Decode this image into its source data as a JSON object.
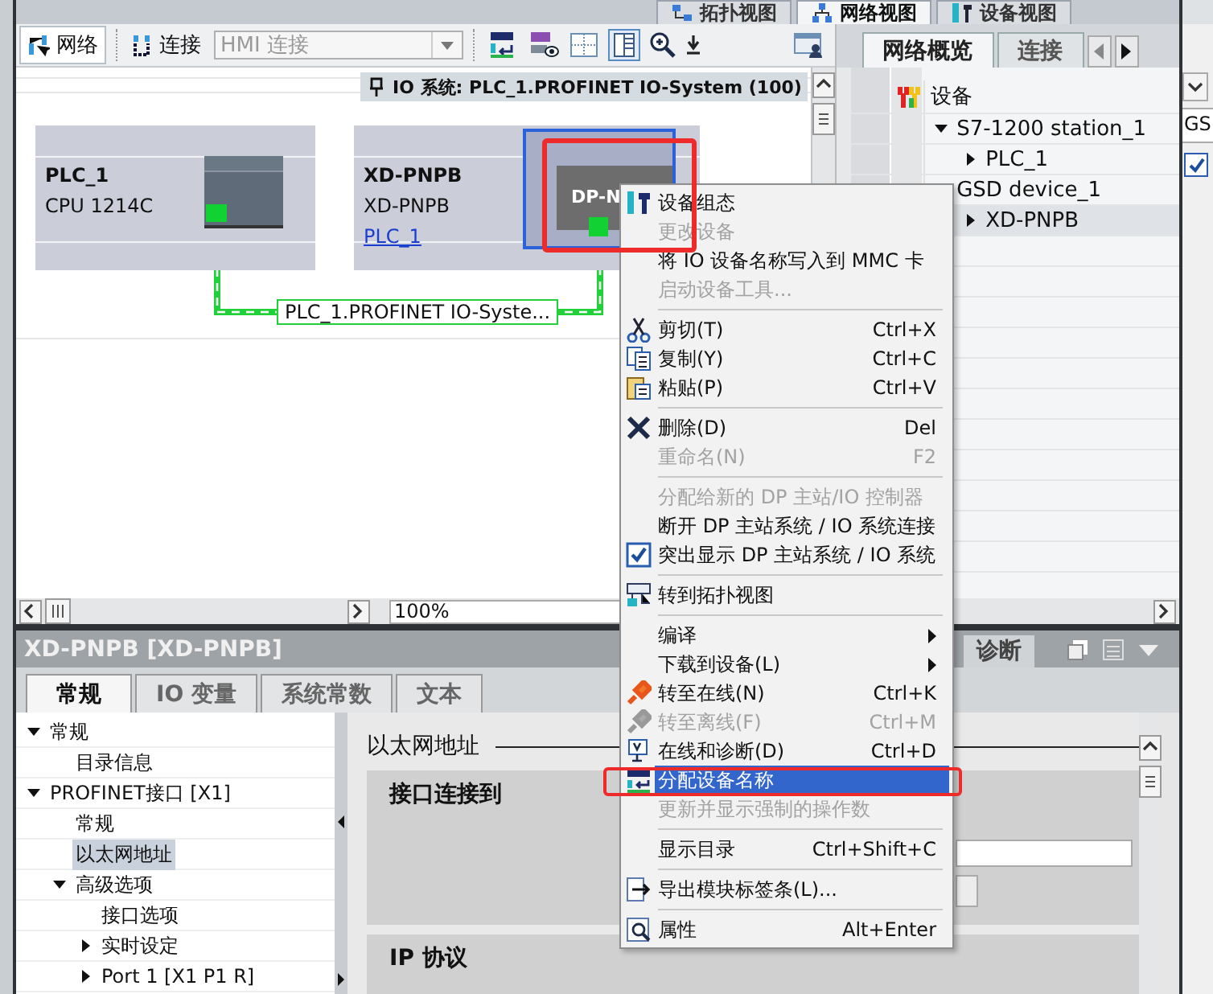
{
  "view_tabs": [
    {
      "label": "拓扑视图",
      "selected": false
    },
    {
      "label": "网络视图",
      "selected": true
    },
    {
      "label": "设备视图",
      "selected": false
    }
  ],
  "side_panel": {
    "field": "GS",
    "checked": true
  },
  "toolbar": {
    "network_button": "网络",
    "connections_label": "连接",
    "connection_type": "HMI 连接"
  },
  "io_system": "IO 系统: PLC_1.PROFINET IO-System (100)",
  "devices": [
    {
      "kind": "plc",
      "name": "PLC_1",
      "type": "CPU 1214C",
      "selected": false
    },
    {
      "kind": "io_device",
      "name": "XD-PNPB",
      "type": "XD-PNPB",
      "controller": "PLC_1",
      "module": "DP-N",
      "selected": true
    }
  ],
  "subnet_label": "PLC_1.PROFINET IO-Syste...",
  "zoom": "100%",
  "overview": {
    "tabs": [
      {
        "label": "网络概览",
        "selected": true
      },
      {
        "label": "连接",
        "selected": false
      }
    ],
    "column": "设备",
    "rows": [
      {
        "label": "S7-1200 station_1",
        "expanded": true,
        "selected": false,
        "children": [
          {
            "label": "PLC_1",
            "expanded": false,
            "selected": false
          }
        ]
      },
      {
        "label": "GSD device_1",
        "selected": false,
        "children": [
          {
            "label": "XD-PNPB",
            "expanded": false,
            "selected": true
          }
        ]
      }
    ]
  },
  "properties": {
    "title": "XD-PNPB [XD-PNPB]",
    "side_tab": "诊断",
    "tabs": [
      {
        "label": "常规",
        "selected": true
      },
      {
        "label": "IO 变量",
        "selected": false
      },
      {
        "label": "系统常数",
        "selected": false
      },
      {
        "label": "文本",
        "selected": false
      }
    ],
    "tree": [
      {
        "label": "常规",
        "expanded": true,
        "selected": false,
        "children": [
          {
            "label": "目录信息",
            "selected": false
          }
        ]
      },
      {
        "label": "PROFINET接口 [X1]",
        "expanded": true,
        "selected": false,
        "children": [
          {
            "label": "常规",
            "selected": false
          },
          {
            "label": "以太网地址",
            "selected": true
          },
          {
            "label": "高级选项",
            "expanded": true,
            "selected": false,
            "children": [
              {
                "label": "接口选项",
                "selected": false
              },
              {
                "label": "实时设定",
                "expanded": false,
                "selected": false
              },
              {
                "label": "Port 1 [X1 P1 R]",
                "expanded": false,
                "selected": false
              }
            ]
          }
        ]
      }
    ],
    "section": "以太网地址",
    "groups": [
      "接口连接到",
      "IP 协议"
    ]
  },
  "context_menu": [
    {
      "kind": "command",
      "label": "设备组态",
      "disabled": false,
      "selected": false
    },
    {
      "kind": "command",
      "label": "更改设备",
      "disabled": true,
      "selected": false
    },
    {
      "kind": "command",
      "label": "将 IO 设备名称写入到 MMC 卡",
      "disabled": false,
      "selected": false
    },
    {
      "kind": "command",
      "label": "启动设备工具...",
      "disabled": true,
      "selected": false
    },
    {
      "kind": "separator"
    },
    {
      "kind": "command",
      "label": "剪切(T)",
      "shortcut": "Ctrl+X",
      "disabled": false,
      "selected": false
    },
    {
      "kind": "command",
      "label": "复制(Y)",
      "shortcut": "Ctrl+C",
      "disabled": false,
      "selected": false
    },
    {
      "kind": "command",
      "label": "粘贴(P)",
      "shortcut": "Ctrl+V",
      "disabled": false,
      "selected": false
    },
    {
      "kind": "separator"
    },
    {
      "kind": "command",
      "label": "删除(D)",
      "shortcut": "Del",
      "disabled": false,
      "selected": false
    },
    {
      "kind": "command",
      "label": "重命名(N)",
      "shortcut": "F2",
      "disabled": true,
      "selected": false
    },
    {
      "kind": "separator"
    },
    {
      "kind": "command",
      "label": "分配给新的 DP 主站/IO 控制器",
      "disabled": true,
      "selected": false
    },
    {
      "kind": "command",
      "label": "断开 DP 主站系统 / IO 系统连接",
      "disabled": false,
      "selected": false
    },
    {
      "kind": "check",
      "label": "突出显示 DP 主站系统 / IO 系统",
      "checked": true,
      "disabled": false,
      "selected": false
    },
    {
      "kind": "separator"
    },
    {
      "kind": "command",
      "label": "转到拓扑视图",
      "disabled": false,
      "selected": false
    },
    {
      "kind": "separator"
    },
    {
      "kind": "submenu",
      "label": "编译",
      "disabled": false,
      "selected": false
    },
    {
      "kind": "submenu",
      "label": "下载到设备(L)",
      "disabled": false,
      "selected": false
    },
    {
      "kind": "command",
      "label": "转至在线(N)",
      "shortcut": "Ctrl+K",
      "disabled": false,
      "selected": false
    },
    {
      "kind": "command",
      "label": "转至离线(F)",
      "shortcut": "Ctrl+M",
      "disabled": true,
      "selected": false
    },
    {
      "kind": "command",
      "label": "在线和诊断(D)",
      "shortcut": "Ctrl+D",
      "disabled": false,
      "selected": false
    },
    {
      "kind": "command",
      "label": "分配设备名称",
      "disabled": false,
      "selected": true
    },
    {
      "kind": "command",
      "label": "更新并显示强制的操作数",
      "disabled": true,
      "selected": false
    },
    {
      "kind": "separator"
    },
    {
      "kind": "command",
      "label": "显示目录",
      "shortcut": "Ctrl+Shift+C",
      "disabled": false,
      "selected": false
    },
    {
      "kind": "separator"
    },
    {
      "kind": "command",
      "label": "导出模块标签条(L)...",
      "disabled": false,
      "selected": false
    },
    {
      "kind": "separator"
    },
    {
      "kind": "command",
      "label": "属性",
      "shortcut": "Alt+Enter",
      "disabled": false,
      "selected": false
    }
  ]
}
